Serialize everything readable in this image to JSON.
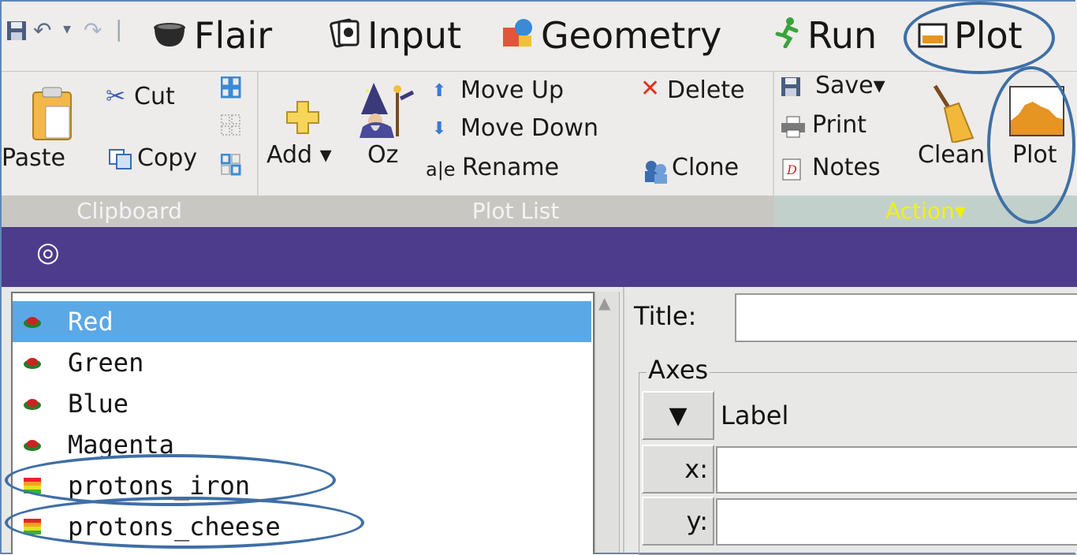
{
  "tabs": [
    {
      "label": "Flair",
      "icon": "cauldron-icon"
    },
    {
      "label": "Input",
      "icon": "cards-icon"
    },
    {
      "label": "Geometry",
      "icon": "geometry-icon"
    },
    {
      "label": "Run",
      "icon": "runner-icon"
    },
    {
      "label": "Plot",
      "icon": "plot-tab-icon"
    }
  ],
  "ribbon": {
    "clipboard": {
      "paste": "Paste",
      "cut": "Cut",
      "copy": "Copy"
    },
    "plotlist": {
      "add": "Add ▾",
      "oz": "Oz",
      "move_up": "Move Up",
      "move_down": "Move Down",
      "rename": "Rename",
      "delete": "Delete",
      "clone": "Clone"
    },
    "action": {
      "save": "Save▾",
      "print": "Print",
      "notes": "Notes",
      "clean": "Clean",
      "plot": "Plot"
    }
  },
  "groups": {
    "clipboard": "Clipboard",
    "plotlist": "Plot List",
    "action": "Action▾"
  },
  "plot_list": [
    {
      "name": "Red",
      "selected": true,
      "icon": "detector-icon"
    },
    {
      "name": "Green",
      "selected": false,
      "icon": "detector-icon"
    },
    {
      "name": "Blue",
      "selected": false,
      "icon": "detector-icon"
    },
    {
      "name": "Magenta",
      "selected": false,
      "icon": "detector-icon"
    },
    {
      "name": "protons_iron",
      "selected": false,
      "icon": "usrbin-icon"
    },
    {
      "name": "protons_cheese",
      "selected": false,
      "icon": "usrbin-icon"
    }
  ],
  "panel": {
    "title_label": "Title:",
    "title_value": "",
    "axes_label": "Axes",
    "label_header": "▼",
    "label_text": "Label",
    "x_label": "x:",
    "y_label": "y:",
    "x_value": "",
    "y_value": ""
  },
  "colors": {
    "accent": "#4d3b8c",
    "selection": "#5aa8e6",
    "annotation": "#3f6fa6",
    "action_label": "#f2f200"
  }
}
